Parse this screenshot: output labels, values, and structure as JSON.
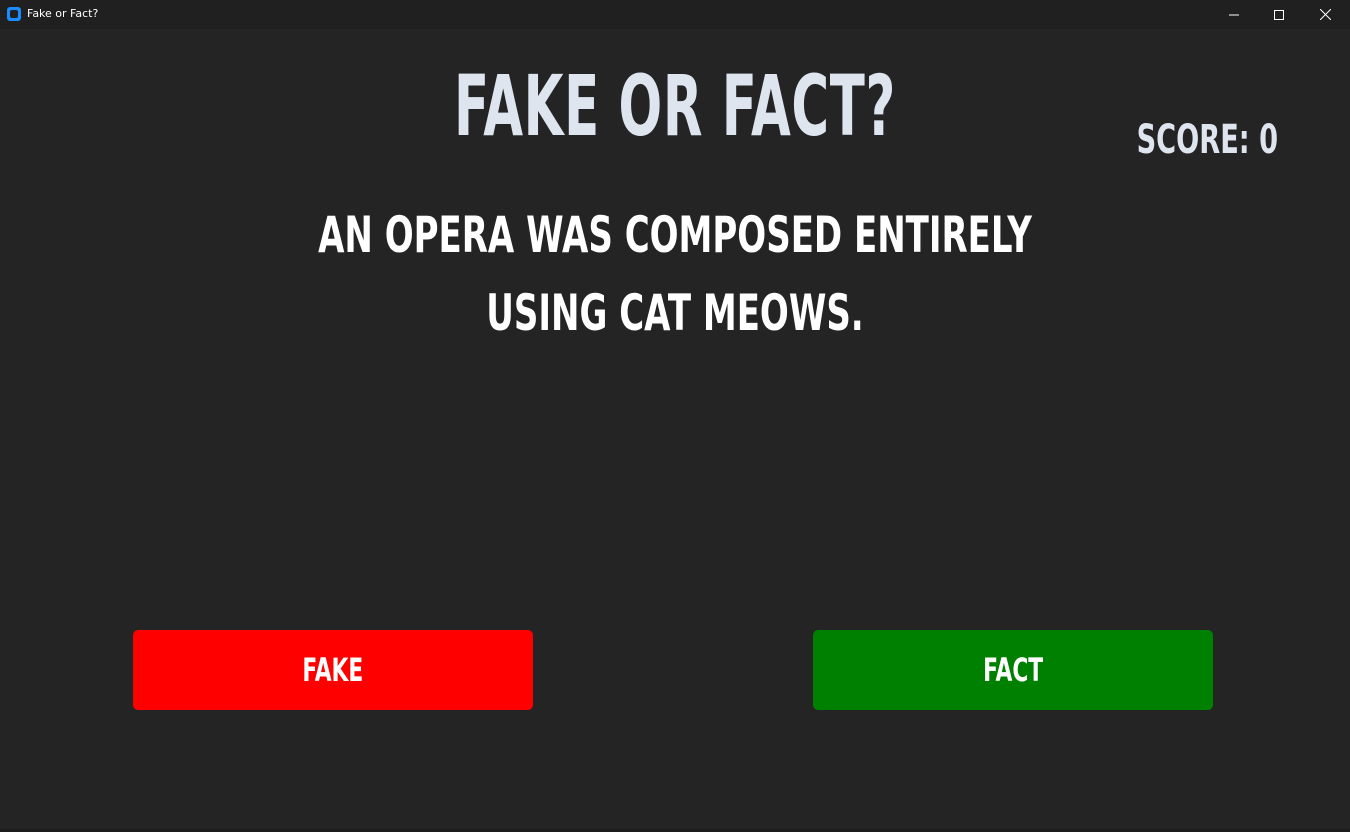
{
  "window": {
    "title": "Fake or Fact?"
  },
  "titlebar": {
    "icons": {
      "app": "app-icon",
      "minimize": "minimize-icon",
      "maximize": "maximize-icon",
      "close": "close-icon"
    }
  },
  "game": {
    "title": "FAKE OR FACT?",
    "score_text": "SCORE: 0",
    "question": "AN OPERA WAS COMPOSED ENTIRELY USING CAT MEOWS."
  },
  "buttons": {
    "fake_label": "FAKE",
    "fact_label": "FACT"
  },
  "colors": {
    "background": "#242424",
    "titlebar": "#202020",
    "title_text": "#dfe5ef",
    "fake_button": "#ff0000",
    "fact_button": "#008000",
    "accent_icon": "#1a8cff"
  }
}
